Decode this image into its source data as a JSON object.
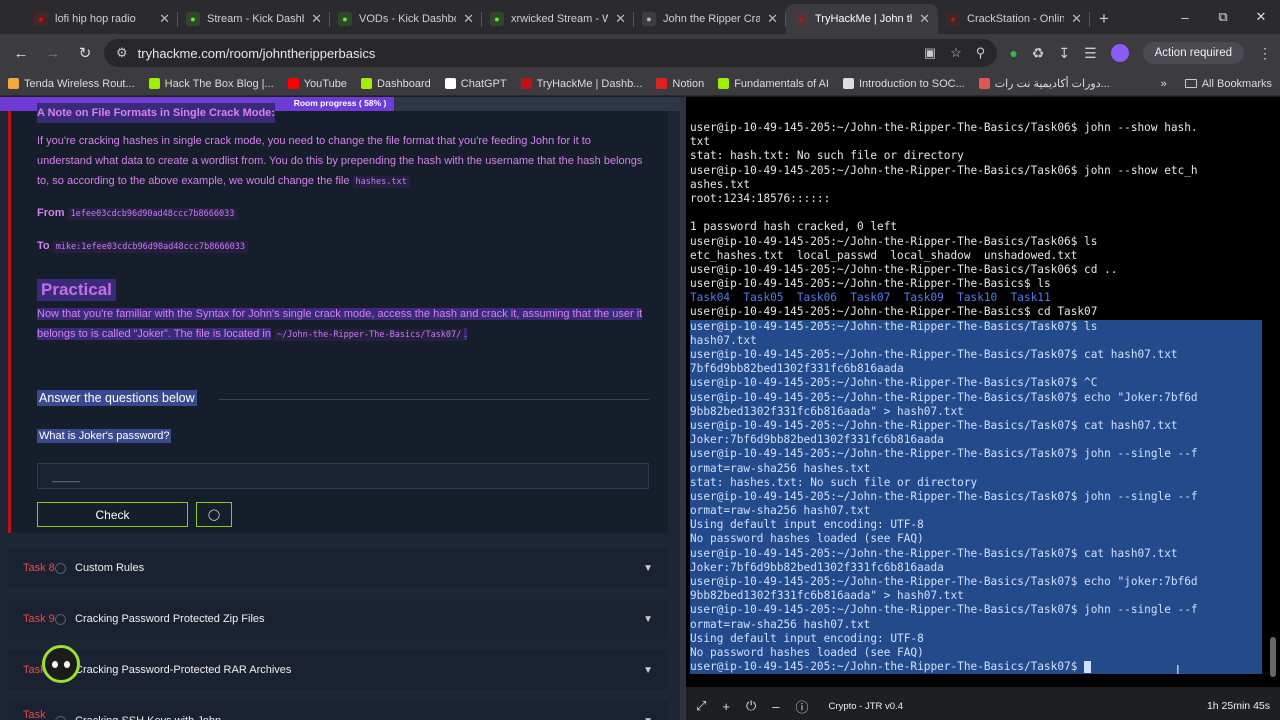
{
  "browser": {
    "tabs": [
      {
        "title": "lofi hip hop radio",
        "icon": "youtube-icon",
        "color": "#ff0000",
        "active": false
      },
      {
        "title": "Stream - Kick Dashbo",
        "icon": "kick-icon",
        "color": "#53fc18",
        "active": false
      },
      {
        "title": "VODs - Kick Dashboar",
        "icon": "kick-icon",
        "color": "#53fc18",
        "active": false
      },
      {
        "title": "xrwicked Stream - W",
        "icon": "kick-icon",
        "color": "#53fc18",
        "active": false
      },
      {
        "title": "John the Ripper Crac",
        "icon": "globe-icon",
        "color": "#bbbbbb",
        "active": false
      },
      {
        "title": "TryHackMe | John the",
        "icon": "tryhackme-icon",
        "color": "#c11111",
        "active": true
      },
      {
        "title": "CrackStation - Online",
        "icon": "crackstation-icon",
        "color": "#c11111",
        "active": false
      }
    ],
    "url": "tryhackme.com/room/johntheripperbasics",
    "action_label": "Action required",
    "bookmarks": [
      {
        "label": "Tenda Wireless Rout...",
        "color": "#f2a83b"
      },
      {
        "label": "Hack The Box Blog |...",
        "color": "#9fef00"
      },
      {
        "label": "YouTube",
        "color": "#ff0000"
      },
      {
        "label": "Dashboard",
        "color": "#9fef00"
      },
      {
        "label": "ChatGPT",
        "color": "#ffffff"
      },
      {
        "label": "TryHackMe | Dashb...",
        "color": "#c11111"
      },
      {
        "label": "Notion",
        "color": "#dd2222"
      },
      {
        "label": "Fundamentals of AI",
        "color": "#9fef00"
      },
      {
        "label": "Introduction to SOC...",
        "color": "#dddddd"
      },
      {
        "label": "دورات أكاديمية نت رات...",
        "color": "#e05555"
      }
    ],
    "all_bookmarks": "All Bookmarks"
  },
  "room": {
    "progress_label": "Room progress ( 58% )",
    "progress": 0.58,
    "partial_heading": "A Note on File Formats in Single Crack Mode:",
    "para1": "If you're cracking hashes in single crack mode, you need to change the file format that you're feeding John for it to understand what data to create a wordlist from. You do this by prepending the hash with the username that the hash belongs to, so according to the above example, we would change the file",
    "para1_code": "hashes.txt",
    "from_label": "From",
    "from_code": "1efee03cdcb96d90ad48ccc7b8666033",
    "to_label": "To",
    "to_code": "mike:1efee03cdcb96d90ad48ccc7b8666033",
    "practical_heading": "Practical",
    "para2": "Now that you're familiar with the Syntax for John's single crack mode, access the hash and crack it, assuming that the user it belongs to is called “Joker”. The file is located in",
    "para2_code": "~/John-the-Ripper-The-Basics/Task07/",
    "para2_end": ".",
    "answer_heading": "Answer the questions below",
    "question": "What is Joker's password?",
    "answer_placeholder": "_____",
    "check_label": "Check",
    "hint_icon": "lightbulb-icon",
    "tasks": [
      {
        "num": "Task 8",
        "title": "Custom Rules"
      },
      {
        "num": "Task 9",
        "title": "Cracking Password Protected Zip Files"
      },
      {
        "num": "Task",
        "title": "Cracking Password-Protected RAR Archives"
      },
      {
        "num": "Task 11",
        "title": "Cracking SSH Keys with John"
      }
    ]
  },
  "terminal": {
    "lines": [
      {
        "text": "user@ip-10-49-145-205:~/John-the-Ripper-The-Basics/Task06$ john --show hash.",
        "sel": false
      },
      {
        "text": "txt",
        "sel": false
      },
      {
        "text": "stat: hash.txt: No such file or directory",
        "sel": false
      },
      {
        "text": "user@ip-10-49-145-205:~/John-the-Ripper-The-Basics/Task06$ john --show etc_h",
        "sel": false
      },
      {
        "text": "ashes.txt",
        "sel": false
      },
      {
        "text": "root:1234:18576::::::",
        "sel": false
      },
      {
        "text": "",
        "sel": false
      },
      {
        "text": "1 password hash cracked, 0 left",
        "sel": false
      },
      {
        "text": "user@ip-10-49-145-205:~/John-the-Ripper-The-Basics/Task06$ ls",
        "sel": false
      },
      {
        "text": "etc_hashes.txt  local_passwd  local_shadow  unshadowed.txt",
        "sel": false
      },
      {
        "text": "user@ip-10-49-145-205:~/John-the-Ripper-The-Basics/Task06$ cd ..",
        "sel": false
      },
      {
        "text": "user@ip-10-49-145-205:~/John-the-Ripper-The-Basics$ ls",
        "sel": false
      },
      {
        "text": "Task04  Task05  Task06  Task07  Task09  Task10  Task11",
        "sel": false,
        "blue": true
      },
      {
        "text": "user@ip-10-49-145-205:~/John-the-Ripper-The-Basics$ cd Task07",
        "sel": false
      },
      {
        "text": "user@ip-10-49-145-205:~/John-the-Ripper-The-Basics/Task07$ ls",
        "sel": true
      },
      {
        "text": "hash07.txt",
        "sel": true
      },
      {
        "text": "user@ip-10-49-145-205:~/John-the-Ripper-The-Basics/Task07$ cat hash07.txt",
        "sel": true
      },
      {
        "text": "7bf6d9bb82bed1302f331fc6b816aada",
        "sel": true
      },
      {
        "text": "user@ip-10-49-145-205:~/John-the-Ripper-The-Basics/Task07$ ^C",
        "sel": true
      },
      {
        "text": "user@ip-10-49-145-205:~/John-the-Ripper-The-Basics/Task07$ echo \"Joker:7bf6d",
        "sel": true
      },
      {
        "text": "9bb82bed1302f331fc6b816aada\" > hash07.txt",
        "sel": true
      },
      {
        "text": "user@ip-10-49-145-205:~/John-the-Ripper-The-Basics/Task07$ cat hash07.txt",
        "sel": true
      },
      {
        "text": "Joker:7bf6d9bb82bed1302f331fc6b816aada",
        "sel": true
      },
      {
        "text": "user@ip-10-49-145-205:~/John-the-Ripper-The-Basics/Task07$ john --single --f",
        "sel": true
      },
      {
        "text": "ormat=raw-sha256 hashes.txt",
        "sel": true
      },
      {
        "text": "stat: hashes.txt: No such file or directory",
        "sel": true
      },
      {
        "text": "user@ip-10-49-145-205:~/John-the-Ripper-The-Basics/Task07$ john --single --f",
        "sel": true
      },
      {
        "text": "ormat=raw-sha256 hash07.txt",
        "sel": true
      },
      {
        "text": "Using default input encoding: UTF-8",
        "sel": true
      },
      {
        "text": "No password hashes loaded (see FAQ)",
        "sel": true
      },
      {
        "text": "user@ip-10-49-145-205:~/John-the-Ripper-The-Basics/Task07$ cat hash07.txt",
        "sel": true
      },
      {
        "text": "Joker:7bf6d9bb82bed1302f331fc6b816aada",
        "sel": true
      },
      {
        "text": "user@ip-10-49-145-205:~/John-the-Ripper-The-Basics/Task07$ echo \"joker:7bf6d",
        "sel": true
      },
      {
        "text": "9bb82bed1302f331fc6b816aada\" > hash07.txt",
        "sel": true
      },
      {
        "text": "user@ip-10-49-145-205:~/John-the-Ripper-The-Basics/Task07$ john --single --f",
        "sel": true
      },
      {
        "text": "ormat=raw-sha256 hash07.txt",
        "sel": true
      },
      {
        "text": "Using default input encoding: UTF-8",
        "sel": true
      },
      {
        "text": "No password hashes loaded (see FAQ)",
        "sel": true
      },
      {
        "text": "user@ip-10-49-145-205:~/John-the-Ripper-The-Basics/Task07$ ",
        "sel": true,
        "cursor": true
      }
    ],
    "machine_name": "Crypto - JTR v0.4",
    "timer": "1h 25min 45s"
  }
}
